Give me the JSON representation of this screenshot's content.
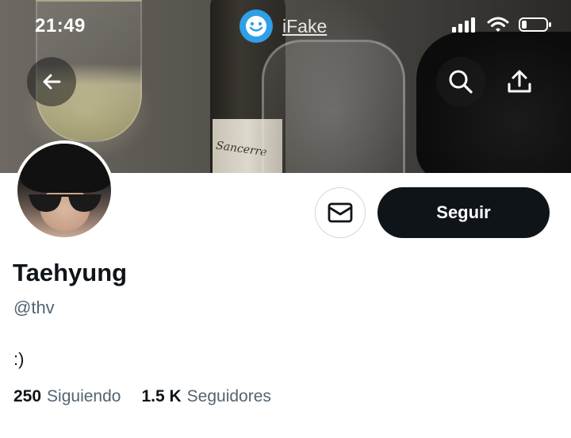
{
  "status_bar": {
    "time": "21:49",
    "app_label": "iFake"
  },
  "banner": {
    "bottle_text": "Sancerre"
  },
  "header_actions": {
    "back_icon": "arrow-left-icon",
    "search_icon": "search-icon",
    "share_icon": "share-icon"
  },
  "profile": {
    "name": "Taehyung",
    "handle": "@thv",
    "bio": ":)",
    "following_count": "250",
    "following_label": "Siguiendo",
    "followers_count": "1.5 K",
    "followers_label": "Seguidores"
  },
  "actions": {
    "follow_label": "Seguir",
    "message_icon": "mail-icon"
  },
  "colors": {
    "follow_bg": "#0f1419",
    "secondary_text": "#536471",
    "ifake_blue": "#2f9fe8"
  }
}
